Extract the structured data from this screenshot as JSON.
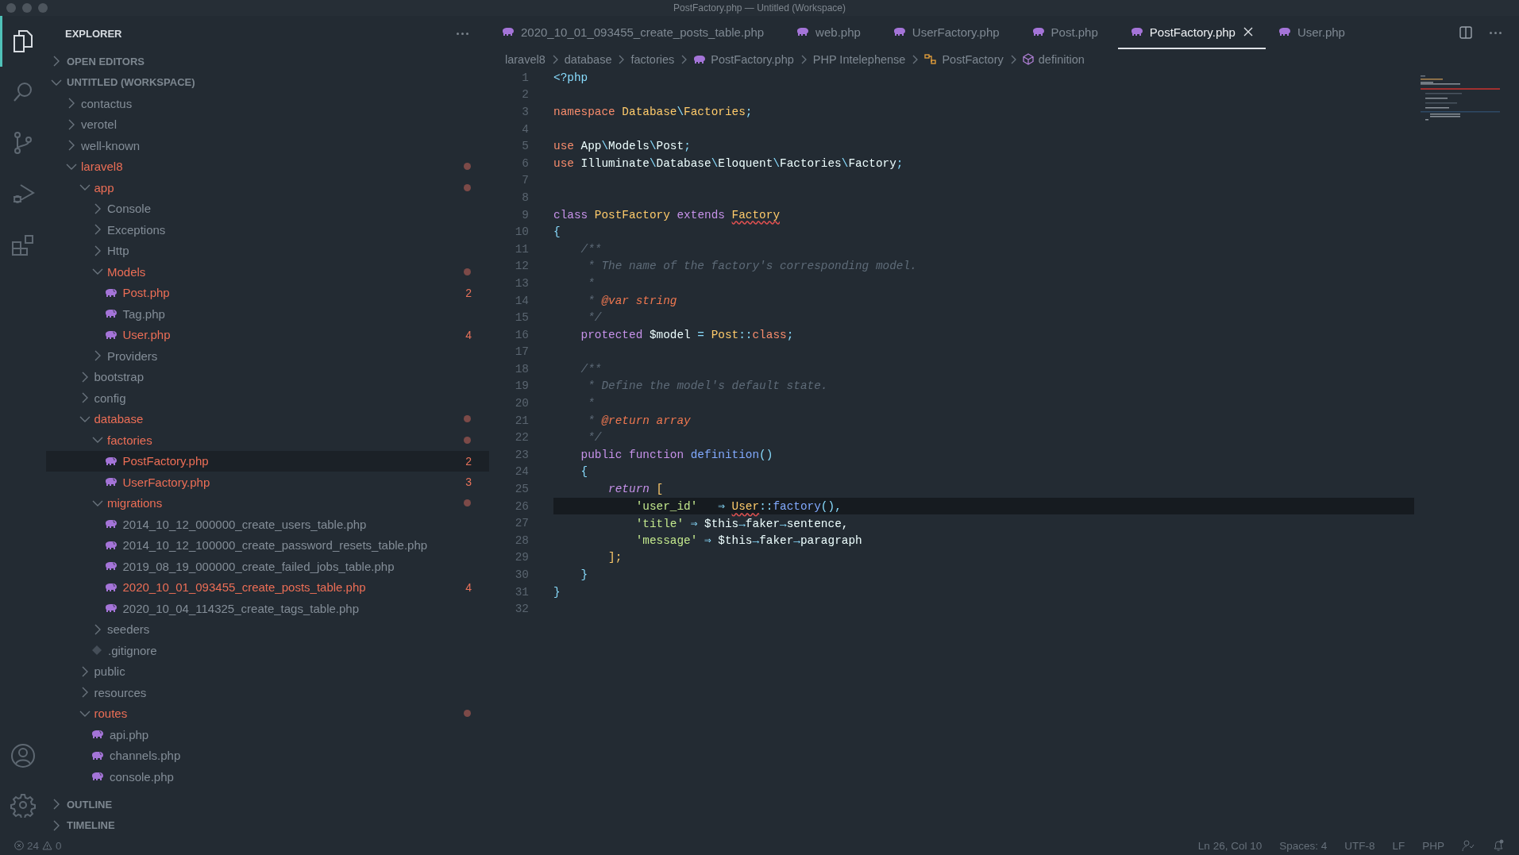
{
  "window": {
    "title": "PostFactory.php — Untitled (Workspace)"
  },
  "activity_bar": {
    "items": [
      {
        "kind": "files",
        "selected": true
      },
      {
        "kind": "search",
        "selected": false
      },
      {
        "kind": "source-control",
        "selected": false
      },
      {
        "kind": "run",
        "selected": false
      },
      {
        "kind": "extensions",
        "selected": false
      }
    ],
    "bottom": [
      {
        "kind": "account"
      },
      {
        "kind": "settings"
      }
    ]
  },
  "explorer": {
    "title": "EXPLORER",
    "sections_top": [
      {
        "label": "OPEN EDITORS",
        "expanded": false
      },
      {
        "label": "UNTITLED (WORKSPACE)",
        "expanded": true
      }
    ],
    "tree": [
      {
        "label": "contactus",
        "kind": "folder",
        "expanded": false,
        "modified": false,
        "dot": false,
        "selected": false
      },
      {
        "label": "verotel",
        "kind": "folder",
        "expanded": false,
        "modified": false,
        "dot": false,
        "selected": false
      },
      {
        "label": "well-known",
        "kind": "folder",
        "expanded": false,
        "modified": false,
        "dot": false,
        "selected": false
      },
      {
        "label": "laravel8",
        "kind": "folder",
        "expanded": true,
        "modified": true,
        "dot": true,
        "selected": false,
        "children": [
          {
            "label": "app",
            "kind": "folder",
            "expanded": true,
            "modified": true,
            "dot": true,
            "selected": false,
            "children": [
              {
                "label": "Console",
                "kind": "folder",
                "expanded": false,
                "modified": false,
                "dot": false,
                "selected": false
              },
              {
                "label": "Exceptions",
                "kind": "folder",
                "expanded": false,
                "modified": false,
                "dot": false,
                "selected": false
              },
              {
                "label": "Http",
                "kind": "folder",
                "expanded": false,
                "modified": false,
                "dot": false,
                "selected": false
              },
              {
                "label": "Models",
                "kind": "folder",
                "expanded": true,
                "modified": true,
                "dot": true,
                "selected": false,
                "children": [
                  {
                    "label": "Post.php",
                    "kind": "php",
                    "modified": true,
                    "badge": "2",
                    "selected": false
                  },
                  {
                    "label": "Tag.php",
                    "kind": "php",
                    "modified": false,
                    "selected": false
                  },
                  {
                    "label": "User.php",
                    "kind": "php",
                    "modified": true,
                    "badge": "4",
                    "selected": false
                  }
                ]
              },
              {
                "label": "Providers",
                "kind": "folder",
                "expanded": false,
                "modified": false,
                "dot": false,
                "selected": false
              }
            ]
          },
          {
            "label": "bootstrap",
            "kind": "folder",
            "expanded": false,
            "modified": false,
            "dot": false,
            "selected": false
          },
          {
            "label": "config",
            "kind": "folder",
            "expanded": false,
            "modified": false,
            "dot": false,
            "selected": false
          },
          {
            "label": "database",
            "kind": "folder",
            "expanded": true,
            "modified": true,
            "dot": true,
            "selected": false,
            "children": [
              {
                "label": "factories",
                "kind": "folder",
                "expanded": true,
                "modified": true,
                "dot": true,
                "selected": false,
                "children": [
                  {
                    "label": "PostFactory.php",
                    "kind": "php",
                    "modified": true,
                    "badge": "2",
                    "selected": true
                  },
                  {
                    "label": "UserFactory.php",
                    "kind": "php",
                    "modified": true,
                    "badge": "3",
                    "selected": false
                  }
                ]
              },
              {
                "label": "migrations",
                "kind": "folder",
                "expanded": true,
                "modified": true,
                "dot": true,
                "selected": false,
                "children": [
                  {
                    "label": "2014_10_12_000000_create_users_table.php",
                    "kind": "php",
                    "modified": false,
                    "selected": false
                  },
                  {
                    "label": "2014_10_12_100000_create_password_resets_table.php",
                    "kind": "php",
                    "modified": false,
                    "selected": false
                  },
                  {
                    "label": "2019_08_19_000000_create_failed_jobs_table.php",
                    "kind": "php",
                    "modified": false,
                    "selected": false
                  },
                  {
                    "label": "2020_10_01_093455_create_posts_table.php",
                    "kind": "php",
                    "modified": true,
                    "badge": "4",
                    "selected": false
                  },
                  {
                    "label": "2020_10_04_114325_create_tags_table.php",
                    "kind": "php",
                    "modified": false,
                    "selected": false
                  }
                ]
              },
              {
                "label": "seeders",
                "kind": "folder",
                "expanded": false,
                "modified": false,
                "dot": false,
                "selected": false
              },
              {
                "label": ".gitignore",
                "kind": "git",
                "modified": false,
                "selected": false
              }
            ]
          },
          {
            "label": "public",
            "kind": "folder",
            "expanded": false,
            "modified": false,
            "dot": false,
            "selected": false
          },
          {
            "label": "resources",
            "kind": "folder",
            "expanded": false,
            "modified": false,
            "dot": false,
            "selected": false
          },
          {
            "label": "routes",
            "kind": "folder",
            "expanded": true,
            "modified": true,
            "dot": true,
            "selected": false,
            "children": [
              {
                "label": "api.php",
                "kind": "php",
                "modified": false,
                "selected": false
              },
              {
                "label": "channels.php",
                "kind": "php",
                "modified": false,
                "selected": false
              },
              {
                "label": "console.php",
                "kind": "php",
                "modified": false,
                "selected": false
              }
            ]
          }
        ]
      }
    ],
    "sections_bottom": [
      {
        "label": "OUTLINE",
        "expanded": false
      },
      {
        "label": "TIMELINE",
        "expanded": false
      }
    ]
  },
  "tabs": [
    {
      "label": "2020_10_01_093455_create_posts_table.php",
      "selected": false
    },
    {
      "label": "web.php",
      "selected": false
    },
    {
      "label": "UserFactory.php",
      "selected": false
    },
    {
      "label": "Post.php",
      "selected": false
    },
    {
      "label": "PostFactory.php",
      "selected": true
    },
    {
      "label": "User.php",
      "selected": false
    }
  ],
  "breadcrumb": [
    {
      "label": "laravel8",
      "kind": "folder"
    },
    {
      "label": "database",
      "kind": "folder"
    },
    {
      "label": "factories",
      "kind": "folder"
    },
    {
      "label": "PostFactory.php",
      "kind": "php"
    },
    {
      "label": "PHP Intelephense",
      "kind": "folder"
    },
    {
      "label": "PostFactory",
      "kind": "class"
    },
    {
      "label": "definition",
      "kind": "method"
    }
  ],
  "code": [
    {
      "number": "1",
      "current": false,
      "tokens": [
        {
          "text": "<?php",
          "kind": "tag"
        }
      ]
    },
    {
      "number": "2",
      "current": false
    },
    {
      "number": "3",
      "current": false,
      "tokens": [
        {
          "text": "namespace ",
          "kind": "kw"
        },
        {
          "text": "Database",
          "kind": "type"
        },
        {
          "text": "\\",
          "kind": "punct"
        },
        {
          "text": "Factories",
          "kind": "type"
        },
        {
          "text": ";",
          "kind": "punct"
        }
      ]
    },
    {
      "number": "4",
      "current": false
    },
    {
      "number": "5",
      "current": false,
      "tokens": [
        {
          "text": "use ",
          "kind": "kw"
        },
        {
          "text": "App",
          "kind": "plain"
        },
        {
          "text": "\\",
          "kind": "punct"
        },
        {
          "text": "Models",
          "kind": "plain"
        },
        {
          "text": "\\",
          "kind": "punct"
        },
        {
          "text": "Post",
          "kind": "plain"
        },
        {
          "text": ";",
          "kind": "punct"
        }
      ]
    },
    {
      "number": "6",
      "current": false,
      "tokens": [
        {
          "text": "use ",
          "kind": "kw"
        },
        {
          "text": "Illuminate",
          "kind": "plain"
        },
        {
          "text": "\\",
          "kind": "punct"
        },
        {
          "text": "Database",
          "kind": "plain"
        },
        {
          "text": "\\",
          "kind": "punct"
        },
        {
          "text": "Eloquent",
          "kind": "plain"
        },
        {
          "text": "\\",
          "kind": "punct"
        },
        {
          "text": "Factories",
          "kind": "plain"
        },
        {
          "text": "\\",
          "kind": "punct"
        },
        {
          "text": "Factory",
          "kind": "plain"
        },
        {
          "text": ";",
          "kind": "punct"
        }
      ]
    },
    {
      "number": "7",
      "current": false
    },
    {
      "number": "8",
      "current": false
    },
    {
      "number": "9",
      "current": false,
      "tokens": [
        {
          "text": "class ",
          "kind": "storage"
        },
        {
          "text": "PostFactory ",
          "kind": "type"
        },
        {
          "text": "extends ",
          "kind": "storage"
        },
        {
          "text": "Factory",
          "kind": "flagged"
        }
      ]
    },
    {
      "number": "10",
      "current": false,
      "tokens": [
        {
          "text": "{",
          "kind": "punct"
        }
      ]
    },
    {
      "number": "11",
      "current": false,
      "tokens": [
        {
          "text": "    /**",
          "kind": "comment"
        }
      ]
    },
    {
      "number": "12",
      "current": false,
      "tokens": [
        {
          "text": "     * The name of the factory's corresponding model.",
          "kind": "comment"
        }
      ]
    },
    {
      "number": "13",
      "current": false,
      "tokens": [
        {
          "text": "     *",
          "kind": "comment"
        }
      ]
    },
    {
      "number": "14",
      "current": false,
      "tokens": [
        {
          "text": "     * ",
          "kind": "comment"
        },
        {
          "text": "@var string",
          "kind": "doctag"
        }
      ]
    },
    {
      "number": "15",
      "current": false,
      "tokens": [
        {
          "text": "     */",
          "kind": "comment"
        }
      ]
    },
    {
      "number": "16",
      "current": false,
      "tokens": [
        {
          "text": "    protected ",
          "kind": "storage"
        },
        {
          "text": "$model ",
          "kind": "plain"
        },
        {
          "text": "= ",
          "kind": "punct"
        },
        {
          "text": "Post",
          "kind": "type"
        },
        {
          "text": "::",
          "kind": "punct"
        },
        {
          "text": "class",
          "kind": "kw"
        },
        {
          "text": ";",
          "kind": "punct"
        }
      ]
    },
    {
      "number": "17",
      "current": false
    },
    {
      "number": "18",
      "current": false,
      "tokens": [
        {
          "text": "    /**",
          "kind": "comment"
        }
      ]
    },
    {
      "number": "19",
      "current": false,
      "tokens": [
        {
          "text": "     * Define the model's default state.",
          "kind": "comment"
        }
      ]
    },
    {
      "number": "20",
      "current": false,
      "tokens": [
        {
          "text": "     *",
          "kind": "comment"
        }
      ]
    },
    {
      "number": "21",
      "current": false,
      "tokens": [
        {
          "text": "     * ",
          "kind": "comment"
        },
        {
          "text": "@return array",
          "kind": "doctag"
        }
      ]
    },
    {
      "number": "22",
      "current": false,
      "tokens": [
        {
          "text": "     */",
          "kind": "comment"
        }
      ]
    },
    {
      "number": "23",
      "current": false,
      "tokens": [
        {
          "text": "    public function ",
          "kind": "storage"
        },
        {
          "text": "definition",
          "kind": "func"
        },
        {
          "text": "()",
          "kind": "punct"
        }
      ]
    },
    {
      "number": "24",
      "current": false,
      "tokens": [
        {
          "text": "    {",
          "kind": "punct"
        }
      ]
    },
    {
      "number": "25",
      "current": false,
      "tokens": [
        {
          "text": "        return ",
          "kind": "ret"
        },
        {
          "text": "[",
          "kind": "type"
        }
      ]
    },
    {
      "number": "26",
      "current": true,
      "tokens": [
        {
          "text": "            'user_id'",
          "kind": "str"
        },
        {
          "text": "   ⇒ ",
          "kind": "punct"
        },
        {
          "text": "User",
          "kind": "flagged"
        },
        {
          "text": "::",
          "kind": "punct"
        },
        {
          "text": "factory",
          "kind": "func"
        },
        {
          "text": "(),",
          "kind": "punct"
        }
      ]
    },
    {
      "number": "27",
      "current": false,
      "tokens": [
        {
          "text": "            'title'",
          "kind": "str"
        },
        {
          "text": " ⇒ ",
          "kind": "punct"
        },
        {
          "text": "$this",
          "kind": "var"
        },
        {
          "text": "→",
          "kind": "punct"
        },
        {
          "text": "faker",
          "kind": "plain"
        },
        {
          "text": "→",
          "kind": "punct"
        },
        {
          "text": "sentence,",
          "kind": "plain"
        }
      ]
    },
    {
      "number": "28",
      "current": false,
      "tokens": [
        {
          "text": "            'message'",
          "kind": "str"
        },
        {
          "text": " ⇒ ",
          "kind": "punct"
        },
        {
          "text": "$this",
          "kind": "var"
        },
        {
          "text": "→",
          "kind": "punct"
        },
        {
          "text": "faker",
          "kind": "plain"
        },
        {
          "text": "→",
          "kind": "punct"
        },
        {
          "text": "paragraph",
          "kind": "plain"
        }
      ]
    },
    {
      "number": "29",
      "current": false,
      "tokens": [
        {
          "text": "        ];",
          "kind": "type"
        }
      ]
    },
    {
      "number": "30",
      "current": false,
      "tokens": [
        {
          "text": "    }",
          "kind": "punct"
        }
      ]
    },
    {
      "number": "31",
      "current": false,
      "tokens": [
        {
          "text": "}",
          "kind": "punct"
        }
      ]
    },
    {
      "number": "32",
      "current": false
    }
  ],
  "status_bar": {
    "errors": "24",
    "warnings": "0",
    "items": [
      "Ln 26, Col 10",
      "Spaces: 4",
      "UTF-8",
      "LF",
      "PHP"
    ]
  }
}
